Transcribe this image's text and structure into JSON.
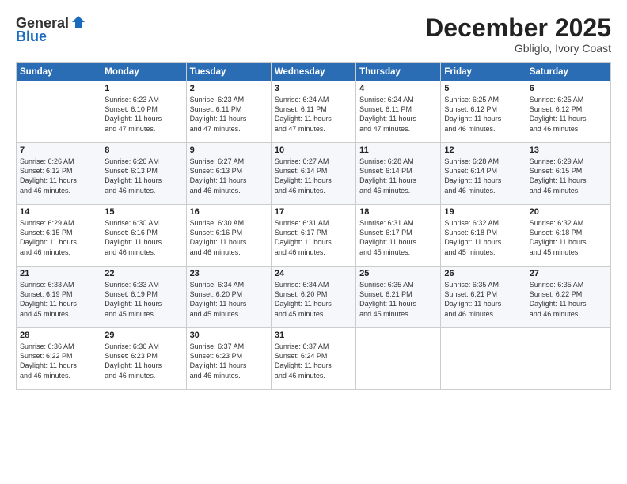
{
  "logo": {
    "line1": "General",
    "line2": "Blue"
  },
  "title": "December 2025",
  "subtitle": "Gbliglo, Ivory Coast",
  "header": {
    "days": [
      "Sunday",
      "Monday",
      "Tuesday",
      "Wednesday",
      "Thursday",
      "Friday",
      "Saturday"
    ]
  },
  "weeks": [
    [
      {
        "day": "",
        "content": ""
      },
      {
        "day": "1",
        "content": "Sunrise: 6:23 AM\nSunset: 6:10 PM\nDaylight: 11 hours\nand 47 minutes."
      },
      {
        "day": "2",
        "content": "Sunrise: 6:23 AM\nSunset: 6:11 PM\nDaylight: 11 hours\nand 47 minutes."
      },
      {
        "day": "3",
        "content": "Sunrise: 6:24 AM\nSunset: 6:11 PM\nDaylight: 11 hours\nand 47 minutes."
      },
      {
        "day": "4",
        "content": "Sunrise: 6:24 AM\nSunset: 6:11 PM\nDaylight: 11 hours\nand 47 minutes."
      },
      {
        "day": "5",
        "content": "Sunrise: 6:25 AM\nSunset: 6:12 PM\nDaylight: 11 hours\nand 46 minutes."
      },
      {
        "day": "6",
        "content": "Sunrise: 6:25 AM\nSunset: 6:12 PM\nDaylight: 11 hours\nand 46 minutes."
      }
    ],
    [
      {
        "day": "7",
        "content": "Sunrise: 6:26 AM\nSunset: 6:12 PM\nDaylight: 11 hours\nand 46 minutes."
      },
      {
        "day": "8",
        "content": "Sunrise: 6:26 AM\nSunset: 6:13 PM\nDaylight: 11 hours\nand 46 minutes."
      },
      {
        "day": "9",
        "content": "Sunrise: 6:27 AM\nSunset: 6:13 PM\nDaylight: 11 hours\nand 46 minutes."
      },
      {
        "day": "10",
        "content": "Sunrise: 6:27 AM\nSunset: 6:14 PM\nDaylight: 11 hours\nand 46 minutes."
      },
      {
        "day": "11",
        "content": "Sunrise: 6:28 AM\nSunset: 6:14 PM\nDaylight: 11 hours\nand 46 minutes."
      },
      {
        "day": "12",
        "content": "Sunrise: 6:28 AM\nSunset: 6:14 PM\nDaylight: 11 hours\nand 46 minutes."
      },
      {
        "day": "13",
        "content": "Sunrise: 6:29 AM\nSunset: 6:15 PM\nDaylight: 11 hours\nand 46 minutes."
      }
    ],
    [
      {
        "day": "14",
        "content": "Sunrise: 6:29 AM\nSunset: 6:15 PM\nDaylight: 11 hours\nand 46 minutes."
      },
      {
        "day": "15",
        "content": "Sunrise: 6:30 AM\nSunset: 6:16 PM\nDaylight: 11 hours\nand 46 minutes."
      },
      {
        "day": "16",
        "content": "Sunrise: 6:30 AM\nSunset: 6:16 PM\nDaylight: 11 hours\nand 46 minutes."
      },
      {
        "day": "17",
        "content": "Sunrise: 6:31 AM\nSunset: 6:17 PM\nDaylight: 11 hours\nand 46 minutes."
      },
      {
        "day": "18",
        "content": "Sunrise: 6:31 AM\nSunset: 6:17 PM\nDaylight: 11 hours\nand 45 minutes."
      },
      {
        "day": "19",
        "content": "Sunrise: 6:32 AM\nSunset: 6:18 PM\nDaylight: 11 hours\nand 45 minutes."
      },
      {
        "day": "20",
        "content": "Sunrise: 6:32 AM\nSunset: 6:18 PM\nDaylight: 11 hours\nand 45 minutes."
      }
    ],
    [
      {
        "day": "21",
        "content": "Sunrise: 6:33 AM\nSunset: 6:19 PM\nDaylight: 11 hours\nand 45 minutes."
      },
      {
        "day": "22",
        "content": "Sunrise: 6:33 AM\nSunset: 6:19 PM\nDaylight: 11 hours\nand 45 minutes."
      },
      {
        "day": "23",
        "content": "Sunrise: 6:34 AM\nSunset: 6:20 PM\nDaylight: 11 hours\nand 45 minutes."
      },
      {
        "day": "24",
        "content": "Sunrise: 6:34 AM\nSunset: 6:20 PM\nDaylight: 11 hours\nand 45 minutes."
      },
      {
        "day": "25",
        "content": "Sunrise: 6:35 AM\nSunset: 6:21 PM\nDaylight: 11 hours\nand 45 minutes."
      },
      {
        "day": "26",
        "content": "Sunrise: 6:35 AM\nSunset: 6:21 PM\nDaylight: 11 hours\nand 46 minutes."
      },
      {
        "day": "27",
        "content": "Sunrise: 6:35 AM\nSunset: 6:22 PM\nDaylight: 11 hours\nand 46 minutes."
      }
    ],
    [
      {
        "day": "28",
        "content": "Sunrise: 6:36 AM\nSunset: 6:22 PM\nDaylight: 11 hours\nand 46 minutes."
      },
      {
        "day": "29",
        "content": "Sunrise: 6:36 AM\nSunset: 6:23 PM\nDaylight: 11 hours\nand 46 minutes."
      },
      {
        "day": "30",
        "content": "Sunrise: 6:37 AM\nSunset: 6:23 PM\nDaylight: 11 hours\nand 46 minutes."
      },
      {
        "day": "31",
        "content": "Sunrise: 6:37 AM\nSunset: 6:24 PM\nDaylight: 11 hours\nand 46 minutes."
      },
      {
        "day": "",
        "content": ""
      },
      {
        "day": "",
        "content": ""
      },
      {
        "day": "",
        "content": ""
      }
    ]
  ]
}
